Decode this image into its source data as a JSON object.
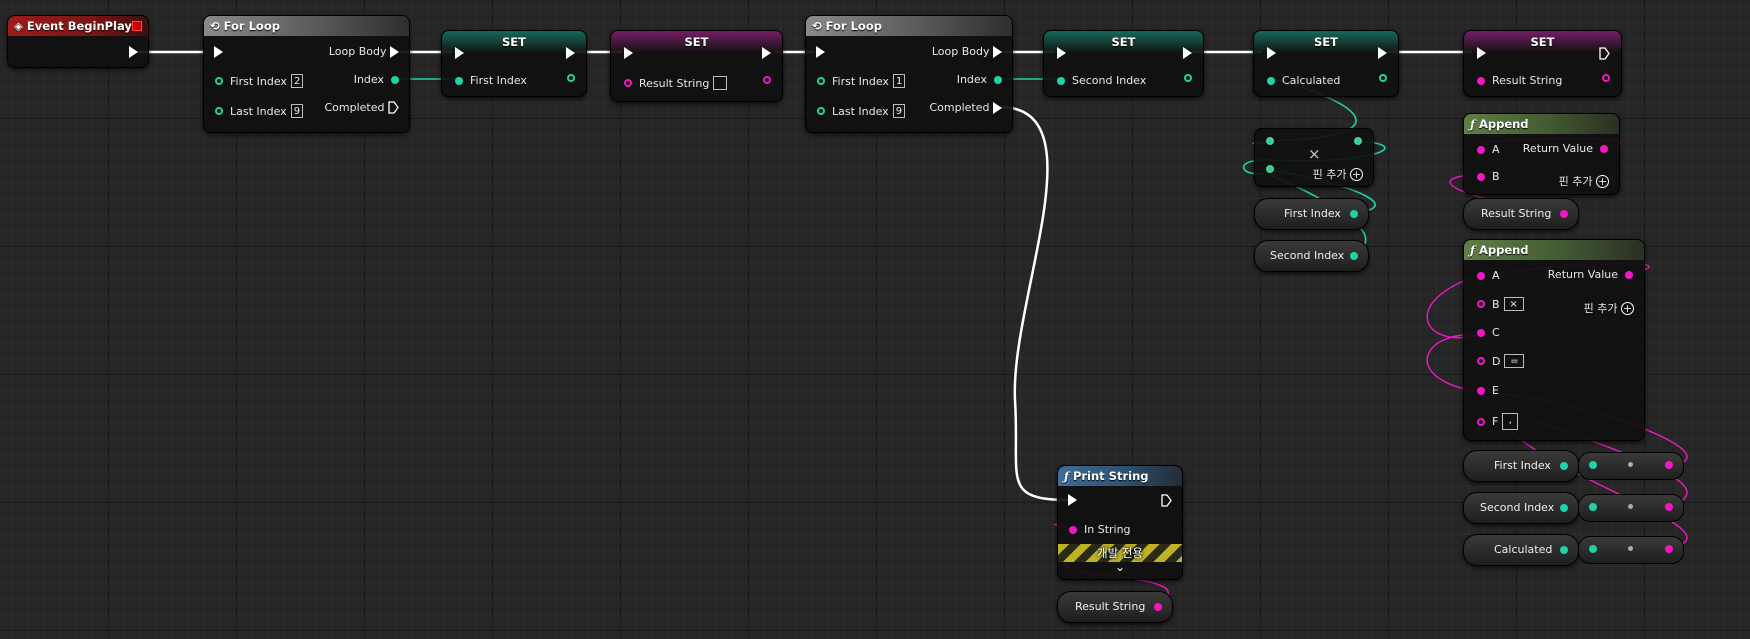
{
  "nodes": {
    "event_begin_play": {
      "title": "Event BeginPlay"
    },
    "for_loop_1": {
      "title": "For Loop",
      "loop_body": "Loop Body",
      "first_index_label": "First Index",
      "first_index_value": "2",
      "index": "Index",
      "last_index_label": "Last Index",
      "last_index_value": "9",
      "completed": "Completed"
    },
    "set_first_index": {
      "title": "SET",
      "pin": "First Index"
    },
    "set_result_string_1": {
      "title": "SET",
      "pin": "Result String",
      "value": ""
    },
    "for_loop_2": {
      "title": "For Loop",
      "loop_body": "Loop Body",
      "first_index_label": "First Index",
      "first_index_value": "1",
      "index": "Index",
      "last_index_label": "Last Index",
      "last_index_value": "9",
      "completed": "Completed"
    },
    "set_second_index": {
      "title": "SET",
      "pin": "Second Index"
    },
    "set_calculated": {
      "title": "SET",
      "pin": "Calculated"
    },
    "set_result_string_2": {
      "title": "SET",
      "pin": "Result String"
    },
    "multiply": {
      "symbol": "×",
      "add_pin": "핀 추가"
    },
    "append_1": {
      "title": "Append",
      "a": "A",
      "b": "B",
      "return_value": "Return Value",
      "add_pin": "핀 추가"
    },
    "append_2": {
      "title": "Append",
      "a": "A",
      "b": "B",
      "b_value": "×",
      "c": "C",
      "d": "D",
      "d_value": "=",
      "e": "E",
      "f": "F",
      "f_value": ",",
      "return_value": "Return Value",
      "add_pin": "핀 추가"
    },
    "print_string": {
      "title": "Print String",
      "in_string": "In String",
      "dev_only": "개발 전용",
      "expand": "⌄"
    }
  },
  "variables": {
    "first_index_getter_1": "First Index",
    "second_index_getter_1": "Second Index",
    "result_string_getter_1": "Result String",
    "first_index_getter_2": "First Index",
    "second_index_getter_2": "Second Index",
    "calculated_getter": "Calculated",
    "result_string_getter_2": "Result String"
  },
  "colors": {
    "exec": "#ffffff",
    "integer_pin": "#1fd3a8",
    "string_pin": "#f018c4",
    "event_header": "#a01a1a",
    "function_header": "#5f7f45",
    "print_header": "#3d6e98"
  },
  "icons": {
    "event": "event-diamond-icon",
    "loop": "loop-macro-icon",
    "function": "function-f-icon"
  }
}
